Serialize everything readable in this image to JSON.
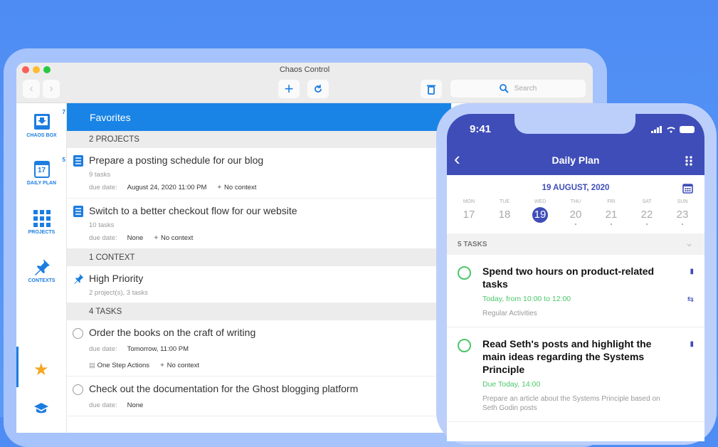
{
  "window": {
    "title": "Chaos Control",
    "search_placeholder": "Search"
  },
  "sidebar": {
    "items": [
      {
        "label": "CHAOS BOX",
        "badge": "7"
      },
      {
        "label": "DAILY PLAN",
        "badge": "5",
        "icon_text": "17"
      },
      {
        "label": "PROJECTS"
      },
      {
        "label": "CONTEXTS"
      }
    ]
  },
  "main": {
    "header": "Favorites",
    "projects_header": "2 PROJECTS",
    "projects": [
      {
        "title": "Prepare a posting schedule for our blog",
        "sub": "9 tasks",
        "due_label": "due date:",
        "due": "August 24, 2020 11:00 PM",
        "context": "No context"
      },
      {
        "title": "Switch to a better checkout flow for our website",
        "sub": "10 tasks",
        "due_label": "due date:",
        "due": "None",
        "context": "No context"
      }
    ],
    "contexts_header": "1 CONTEXT",
    "context": {
      "title": "High Priority",
      "sub": "2 project(s), 3 tasks"
    },
    "tasks_header": "4 TASKS",
    "tasks": [
      {
        "title": "Order the books on the craft of writing",
        "due_label": "due date:",
        "due": "Tomorrow, 11:00 PM",
        "project": "One Step Actions",
        "context": "No context"
      },
      {
        "title": "Check out the documentation for the Ghost blogging platform",
        "due_label": "due date:",
        "due": "None"
      }
    ]
  },
  "phone": {
    "time": "9:41",
    "title": "Daily Plan",
    "date": "19 AUGUST, 2020",
    "days": [
      {
        "n": "MON",
        "d": "17"
      },
      {
        "n": "TUE",
        "d": "18"
      },
      {
        "n": "WED",
        "d": "19"
      },
      {
        "n": "THU",
        "d": "20"
      },
      {
        "n": "FRI",
        "d": "21"
      },
      {
        "n": "SAT",
        "d": "22"
      },
      {
        "n": "SUN",
        "d": "23"
      }
    ],
    "tasks_count": "5 TASKS",
    "tasks": [
      {
        "title": "Spend two hours on product-related tasks",
        "time": "Today, from 10:00 to 12:00",
        "note": "Regular Activities"
      },
      {
        "title": "Read Seth's posts and highlight the main ideas regarding the Systems Principle",
        "time": "Due Today, 14:00",
        "note": "Prepare an article about the Systems Principle based on Seth Godin posts"
      }
    ]
  },
  "colors": {
    "accent": "#1a84e6",
    "phone_accent": "#3f4db8",
    "green": "#4cc76a",
    "star": "#f5a623"
  }
}
